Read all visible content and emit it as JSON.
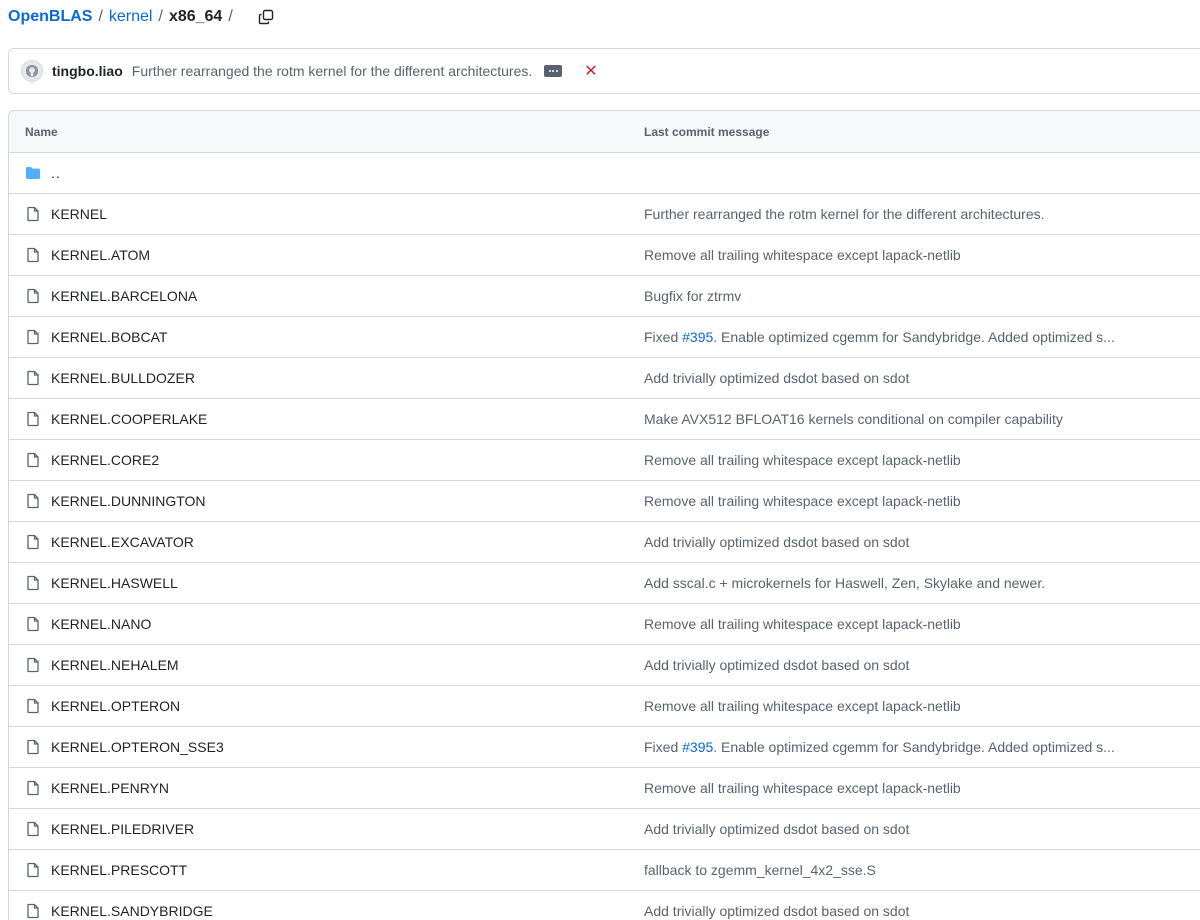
{
  "breadcrumb": {
    "repo": "OpenBLAS",
    "sep1": "/",
    "folder": "kernel",
    "sep2": "/",
    "current": "x86_64",
    "sep3": "/"
  },
  "commit": {
    "author": "tingbo.liao",
    "message": "Further rearranged the rotm kernel for the different architectures.",
    "status": "✕"
  },
  "table": {
    "header_name": "Name",
    "header_message": "Last commit message",
    "parent_label": "..",
    "rows": [
      {
        "name": "KERNEL",
        "msg_pre": "Further rearranged the rotm kernel for the different architectures.",
        "issue": "",
        "msg_post": ""
      },
      {
        "name": "KERNEL.ATOM",
        "msg_pre": "Remove all trailing whitespace except lapack-netlib",
        "issue": "",
        "msg_post": ""
      },
      {
        "name": "KERNEL.BARCELONA",
        "msg_pre": "Bugfix for ztrmv",
        "issue": "",
        "msg_post": ""
      },
      {
        "name": "KERNEL.BOBCAT",
        "msg_pre": "Fixed ",
        "issue": "#395",
        "msg_post": ". Enable optimized cgemm for Sandybridge. Added optimized s..."
      },
      {
        "name": "KERNEL.BULLDOZER",
        "msg_pre": "Add trivially optimized dsdot based on sdot",
        "issue": "",
        "msg_post": ""
      },
      {
        "name": "KERNEL.COOPERLAKE",
        "msg_pre": "Make AVX512 BFLOAT16 kernels conditional on compiler capability",
        "issue": "",
        "msg_post": ""
      },
      {
        "name": "KERNEL.CORE2",
        "msg_pre": "Remove all trailing whitespace except lapack-netlib",
        "issue": "",
        "msg_post": ""
      },
      {
        "name": "KERNEL.DUNNINGTON",
        "msg_pre": "Remove all trailing whitespace except lapack-netlib",
        "issue": "",
        "msg_post": ""
      },
      {
        "name": "KERNEL.EXCAVATOR",
        "msg_pre": "Add trivially optimized dsdot based on sdot",
        "issue": "",
        "msg_post": ""
      },
      {
        "name": "KERNEL.HASWELL",
        "msg_pre": "Add sscal.c + microkernels for Haswell, Zen, Skylake and newer.",
        "issue": "",
        "msg_post": ""
      },
      {
        "name": "KERNEL.NANO",
        "msg_pre": "Remove all trailing whitespace except lapack-netlib",
        "issue": "",
        "msg_post": ""
      },
      {
        "name": "KERNEL.NEHALEM",
        "msg_pre": "Add trivially optimized dsdot based on sdot",
        "issue": "",
        "msg_post": ""
      },
      {
        "name": "KERNEL.OPTERON",
        "msg_pre": "Remove all trailing whitespace except lapack-netlib",
        "issue": "",
        "msg_post": ""
      },
      {
        "name": "KERNEL.OPTERON_SSE3",
        "msg_pre": "Fixed ",
        "issue": "#395",
        "msg_post": ". Enable optimized cgemm for Sandybridge. Added optimized s..."
      },
      {
        "name": "KERNEL.PENRYN",
        "msg_pre": "Remove all trailing whitespace except lapack-netlib",
        "issue": "",
        "msg_post": ""
      },
      {
        "name": "KERNEL.PILEDRIVER",
        "msg_pre": "Add trivially optimized dsdot based on sdot",
        "issue": "",
        "msg_post": ""
      },
      {
        "name": "KERNEL.PRESCOTT",
        "msg_pre": "fallback to zgemm_kernel_4x2_sse.S",
        "issue": "",
        "msg_post": ""
      },
      {
        "name": "KERNEL.SANDYBRIDGE",
        "msg_pre": "Add trivially optimized dsdot based on sdot",
        "issue": "",
        "msg_post": ""
      }
    ]
  },
  "colors": {
    "link": "#0969da",
    "muted": "#59636e",
    "border": "#d1d9e0",
    "folder": "#54aeff",
    "error": "#d1242f"
  },
  "icons": {
    "copy": "copy-icon",
    "folder": "folder-icon",
    "file": "file-icon",
    "avatar": "github-mark-icon"
  }
}
